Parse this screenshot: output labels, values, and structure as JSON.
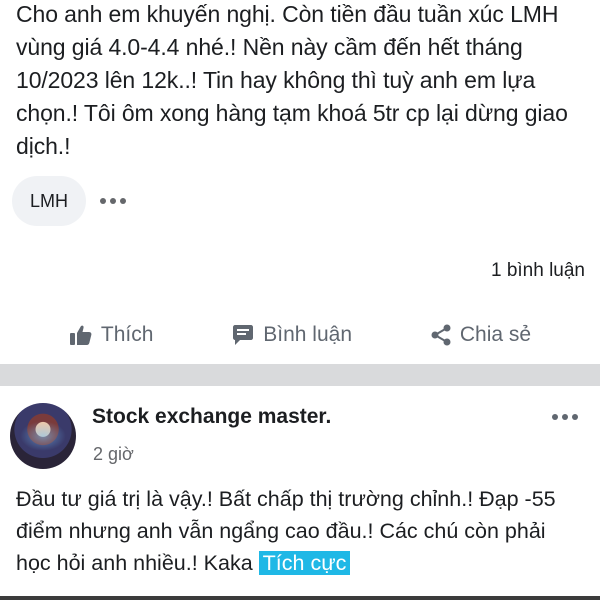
{
  "post1": {
    "text": "Cho anh em khuyến nghị. Còn tiền đầu tuần xúc LMH vùng giá 4.0-4.4 nhé.! Nền này cầm đến hết tháng 10/2023 lên 12k..! Tin hay không thì tuỳ anh em lựa chọn.! Tôi ôm xong hàng tạm khoá 5tr cp lại dừng giao dịch.!",
    "tag": "LMH",
    "comment_count": "1 bình luận",
    "actions": {
      "like": "Thích",
      "comment": "Bình luận",
      "share": "Chia sẻ"
    }
  },
  "post2": {
    "author": "Stock exchange master.",
    "time": "2 giờ",
    "text": "Đầu tư giá trị là vậy.! Bất chấp thị trường chỉnh.! Đạp -55 điểm nhưng anh vẫn ngẩng cao đầu.! Các chú còn phải học hỏi anh nhiều.! Kaka",
    "badge": "Tích cực"
  },
  "colors": {
    "badge_bg": "#1fb8e6",
    "separator": "#d9dadc",
    "action_text": "#606770"
  },
  "icons": [
    "thumbs-up-icon",
    "comment-icon",
    "share-icon",
    "more-dots-icon"
  ]
}
